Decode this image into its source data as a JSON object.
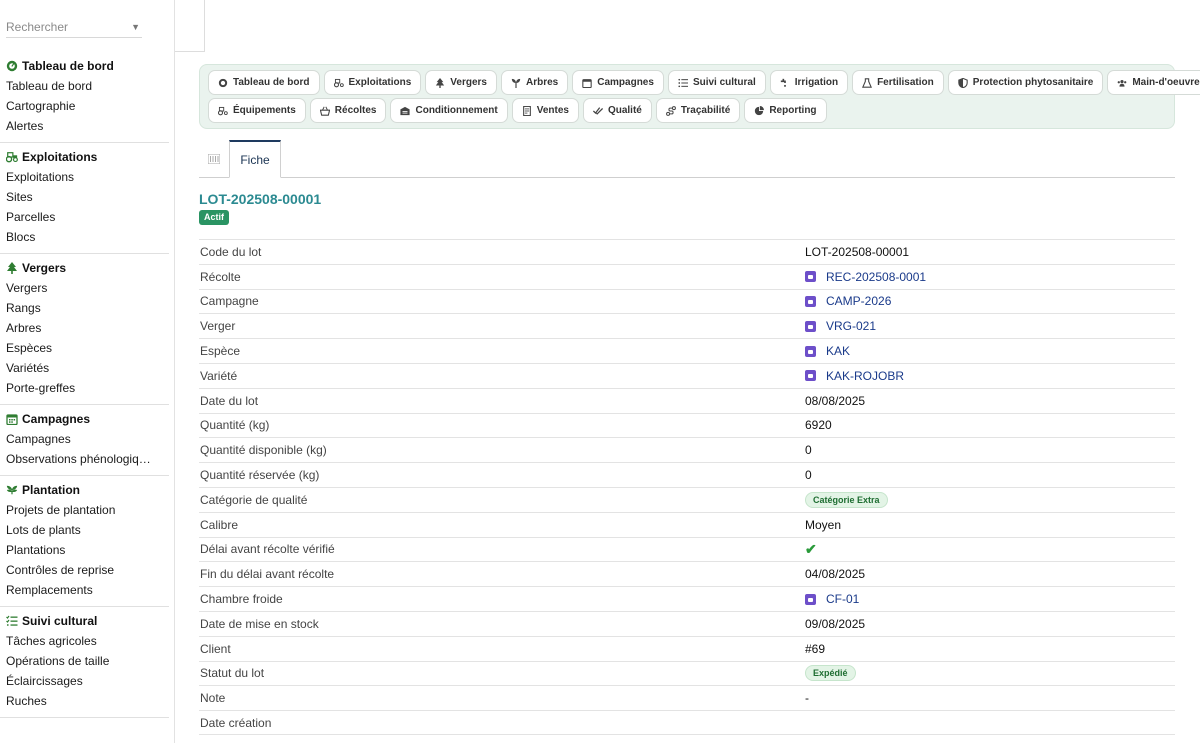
{
  "search": {
    "placeholder": "Rechercher"
  },
  "sidebar": {
    "groups": [
      {
        "title": "Tableau de bord",
        "icon": "gauge-icon",
        "items": [
          "Tableau de bord",
          "Cartographie",
          "Alertes"
        ]
      },
      {
        "title": "Exploitations",
        "icon": "tractor-icon",
        "items": [
          "Exploitations",
          "Sites",
          "Parcelles",
          "Blocs"
        ]
      },
      {
        "title": "Vergers",
        "icon": "tree-icon",
        "items": [
          "Vergers",
          "Rangs",
          "Arbres",
          "Espèces",
          "Variétés",
          "Porte-greffes"
        ]
      },
      {
        "title": "Campagnes",
        "icon": "calendar-icon",
        "items": [
          "Campagnes",
          "Observations phénologiq…"
        ]
      },
      {
        "title": "Plantation",
        "icon": "sprout-icon",
        "items": [
          "Projets de plantation",
          "Lots de plants",
          "Plantations",
          "Contrôles de reprise",
          "Remplacements"
        ]
      },
      {
        "title": "Suivi cultural",
        "icon": "list-check-icon",
        "items": [
          "Tâches agricoles",
          "Opérations de taille",
          "Éclaircissages",
          "Ruches"
        ]
      }
    ]
  },
  "modules": {
    "row1": [
      {
        "label": "Tableau de bord",
        "icon": "gauge-icon"
      },
      {
        "label": "Exploitations",
        "icon": "tractor-icon"
      },
      {
        "label": "Vergers",
        "icon": "tree-icon"
      },
      {
        "label": "Arbres",
        "icon": "seedling-icon"
      },
      {
        "label": "Campagnes",
        "icon": "calendar-icon"
      },
      {
        "label": "Suivi cultural",
        "icon": "list-check-icon"
      },
      {
        "label": "Irrigation",
        "icon": "faucet-icon"
      },
      {
        "label": "Fertilisation",
        "icon": "flask-icon"
      },
      {
        "label": "Protection phytosanitaire",
        "icon": "shield-icon"
      },
      {
        "label": "Main-d'oeuvre",
        "icon": "users-icon"
      }
    ],
    "row2": [
      {
        "label": "Équipements",
        "icon": "tractor-icon"
      },
      {
        "label": "Récoltes",
        "icon": "basket-icon"
      },
      {
        "label": "Conditionnement",
        "icon": "warehouse-icon"
      },
      {
        "label": "Ventes",
        "icon": "invoice-icon"
      },
      {
        "label": "Qualité",
        "icon": "check-double-icon"
      },
      {
        "label": "Traçabilité",
        "icon": "route-icon"
      },
      {
        "label": "Reporting",
        "icon": "pie-chart-icon"
      }
    ]
  },
  "tabs": {
    "fiche": "Fiche"
  },
  "lot": {
    "title": "LOT-202508-00001",
    "status": "Actif"
  },
  "fields": {
    "code_du_lot": {
      "label": "Code du lot",
      "value": "LOT-202508-00001"
    },
    "recolte": {
      "label": "Récolte",
      "value": "REC-202508-0001"
    },
    "campagne": {
      "label": "Campagne",
      "value": "CAMP-2026"
    },
    "verger": {
      "label": "Verger",
      "value": "VRG-021"
    },
    "espece": {
      "label": "Espèce",
      "value": "KAK"
    },
    "variete": {
      "label": "Variété",
      "value": "KAK-ROJOBR"
    },
    "date_du_lot": {
      "label": "Date du lot",
      "value": "08/08/2025"
    },
    "quantite": {
      "label": "Quantité (kg)",
      "value": "6920"
    },
    "quantite_disponible": {
      "label": "Quantité disponible (kg)",
      "value": "0"
    },
    "quantite_reservee": {
      "label": "Quantité réservée (kg)",
      "value": "0"
    },
    "categorie_qualite": {
      "label": "Catégorie de qualité",
      "value": "Catégorie Extra"
    },
    "calibre": {
      "label": "Calibre",
      "value": "Moyen"
    },
    "delai_verifie": {
      "label": "Délai avant récolte vérifié",
      "value": "✔"
    },
    "fin_delai": {
      "label": "Fin du délai avant récolte",
      "value": "04/08/2025"
    },
    "chambre_froide": {
      "label": "Chambre froide",
      "value": "CF-01"
    },
    "date_mise_stock": {
      "label": "Date de mise en stock",
      "value": "09/08/2025"
    },
    "client": {
      "label": "Client",
      "value": "#69"
    },
    "statut_lot": {
      "label": "Statut du lot",
      "value": "Expédié"
    },
    "note": {
      "label": "Note",
      "value": "-"
    },
    "date_creation": {
      "label": "Date création",
      "value": ""
    }
  },
  "colors": {
    "accent": "#2b8a91",
    "status_green": "#2a9463",
    "link": "#1a3a8a",
    "link_icon": "#6d4fc9",
    "module_bg": "#eaf3ee"
  }
}
